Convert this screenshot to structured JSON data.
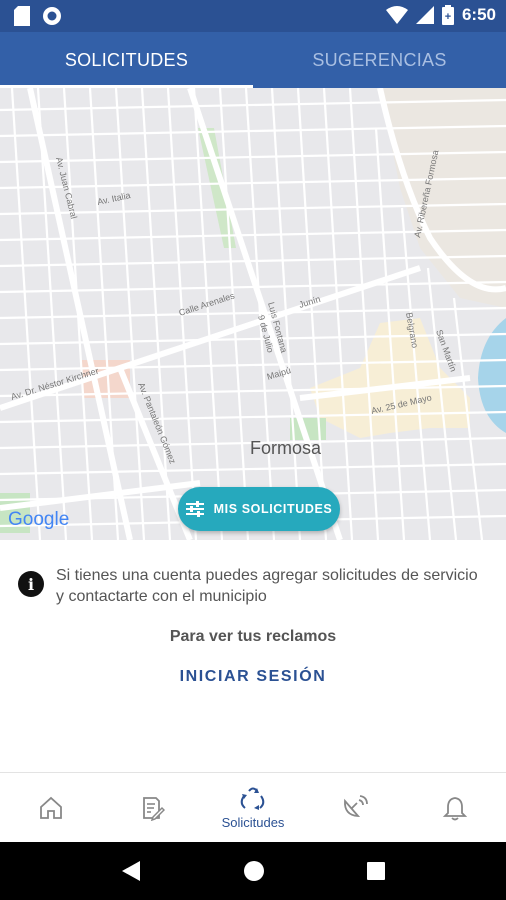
{
  "status_bar": {
    "time": "6:50"
  },
  "tabs": [
    {
      "label": "SOLICITUDES",
      "active": true
    },
    {
      "label": "SUGERENCIAS",
      "active": false
    }
  ],
  "map": {
    "city_label": "Formosa",
    "street_labels": [
      "Av. Juan Cabral",
      "Av. Italia",
      "Calle Arenales",
      "Av. Dr. Néstor Kirchner",
      "Av. Pantaleón Gómez",
      "Luis Fontana",
      "9 de Julio",
      "Junín",
      "Maipú",
      "Belgrano",
      "San Martín",
      "Av. 25 de Mayo",
      "Av. Ribereña Formosa"
    ],
    "provider_logo": "Google"
  },
  "fab": {
    "label": "MIS SOLICITUDES",
    "icon": "filter-sliders-icon",
    "color": "#26a9bd"
  },
  "info": {
    "message": "Si tienes una cuenta puedes agregar solicitudes de servicio y contactarte con el municipio"
  },
  "prompt": "Para ver tus reclamos",
  "login_label": "INICIAR SESIÓN",
  "bottom_nav": [
    {
      "icon": "home-icon",
      "label": ""
    },
    {
      "icon": "document-edit-icon",
      "label": ""
    },
    {
      "icon": "recycle-icon",
      "label": "Solicitudes",
      "active": true
    },
    {
      "icon": "satellite-dish-icon",
      "label": ""
    },
    {
      "icon": "bell-icon",
      "label": ""
    }
  ],
  "colors": {
    "primary": "#3360a8",
    "status": "#2b5193",
    "accent": "#26a9bd"
  }
}
